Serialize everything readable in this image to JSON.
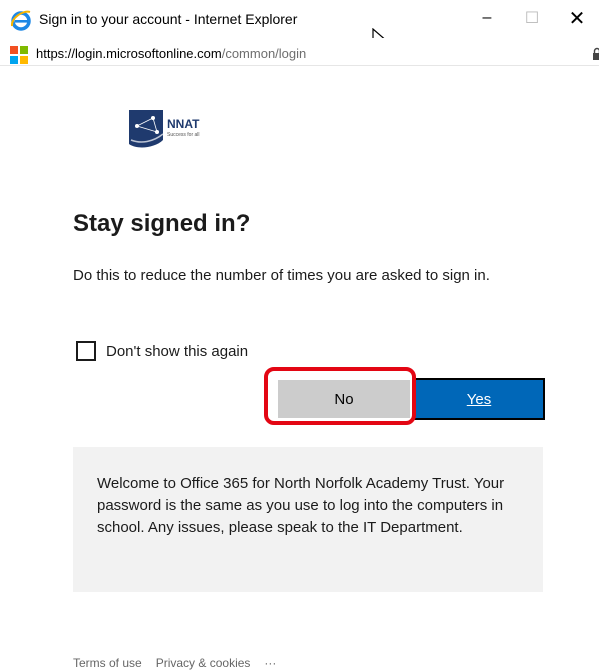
{
  "window": {
    "title": "Sign in to your account - Internet Explorer",
    "controls": {
      "minimize": "–",
      "maximize": "☐",
      "close": "✕"
    }
  },
  "address": {
    "scheme": "https://",
    "host": "login.microsoftonline.com",
    "path": "/common/login"
  },
  "branding": {
    "org_name": "NNAT",
    "tagline": "Success for all",
    "logo_color": "#1f3a6e"
  },
  "dialog": {
    "heading": "Stay signed in?",
    "description": "Do this to reduce the number of times you are asked to sign in.",
    "checkbox_label": "Don't show this again",
    "no_label": "No",
    "yes_label": "Yes",
    "accent_color": "#0067b8",
    "highlight_color": "#e30613"
  },
  "banner": {
    "text": "Welcome to Office 365 for North Norfolk Academy Trust. Your password is the same as you use to log into the computers in school. Any issues, please speak to the IT Department."
  },
  "footer": {
    "terms": "Terms of use",
    "privacy": "Privacy & cookies",
    "more": "···"
  }
}
